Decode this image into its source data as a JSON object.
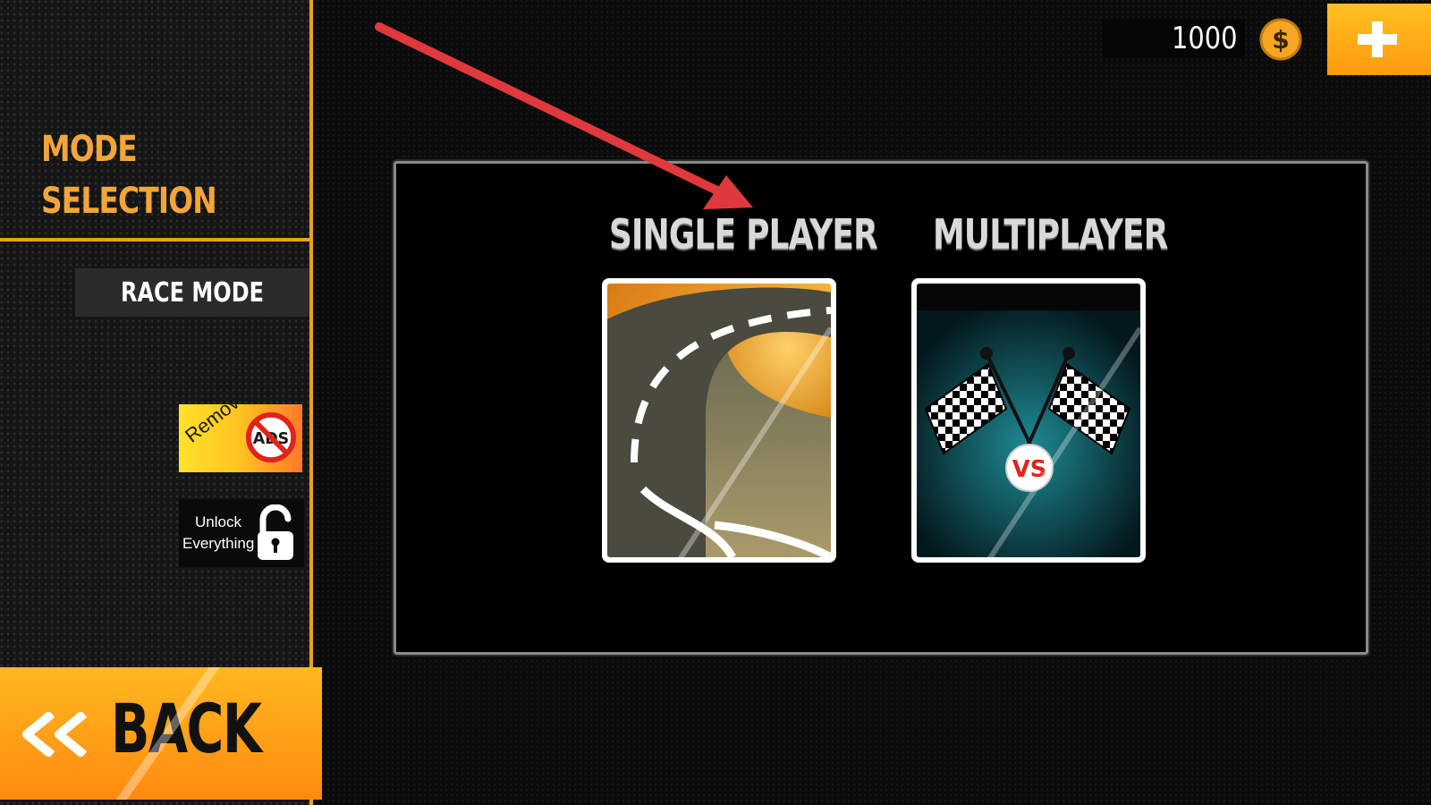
{
  "sidebar": {
    "title_line1": "MODE",
    "title_line2": "SELECTION",
    "race_mode_label": "RACE MODE",
    "remove_ads": {
      "label": "Remove",
      "badge": "ADS"
    },
    "unlock": {
      "line1": "Unlock",
      "line2": "Everything"
    },
    "back_label": "BACK"
  },
  "topbar": {
    "coins": "1000",
    "coin_symbol": "$",
    "plus_icon": "plus-icon"
  },
  "modes": [
    {
      "title": "SINGLE PLAYER",
      "image": "winding-road-image"
    },
    {
      "title": "MULTIPLAYER",
      "image": "checkered-flags-vs-image",
      "badge": "VS"
    }
  ],
  "colors": {
    "accent": "#e8a21c",
    "title": "#f2a63a",
    "button_orange": "#ff9a10",
    "annotation_arrow": "#e0393d"
  }
}
